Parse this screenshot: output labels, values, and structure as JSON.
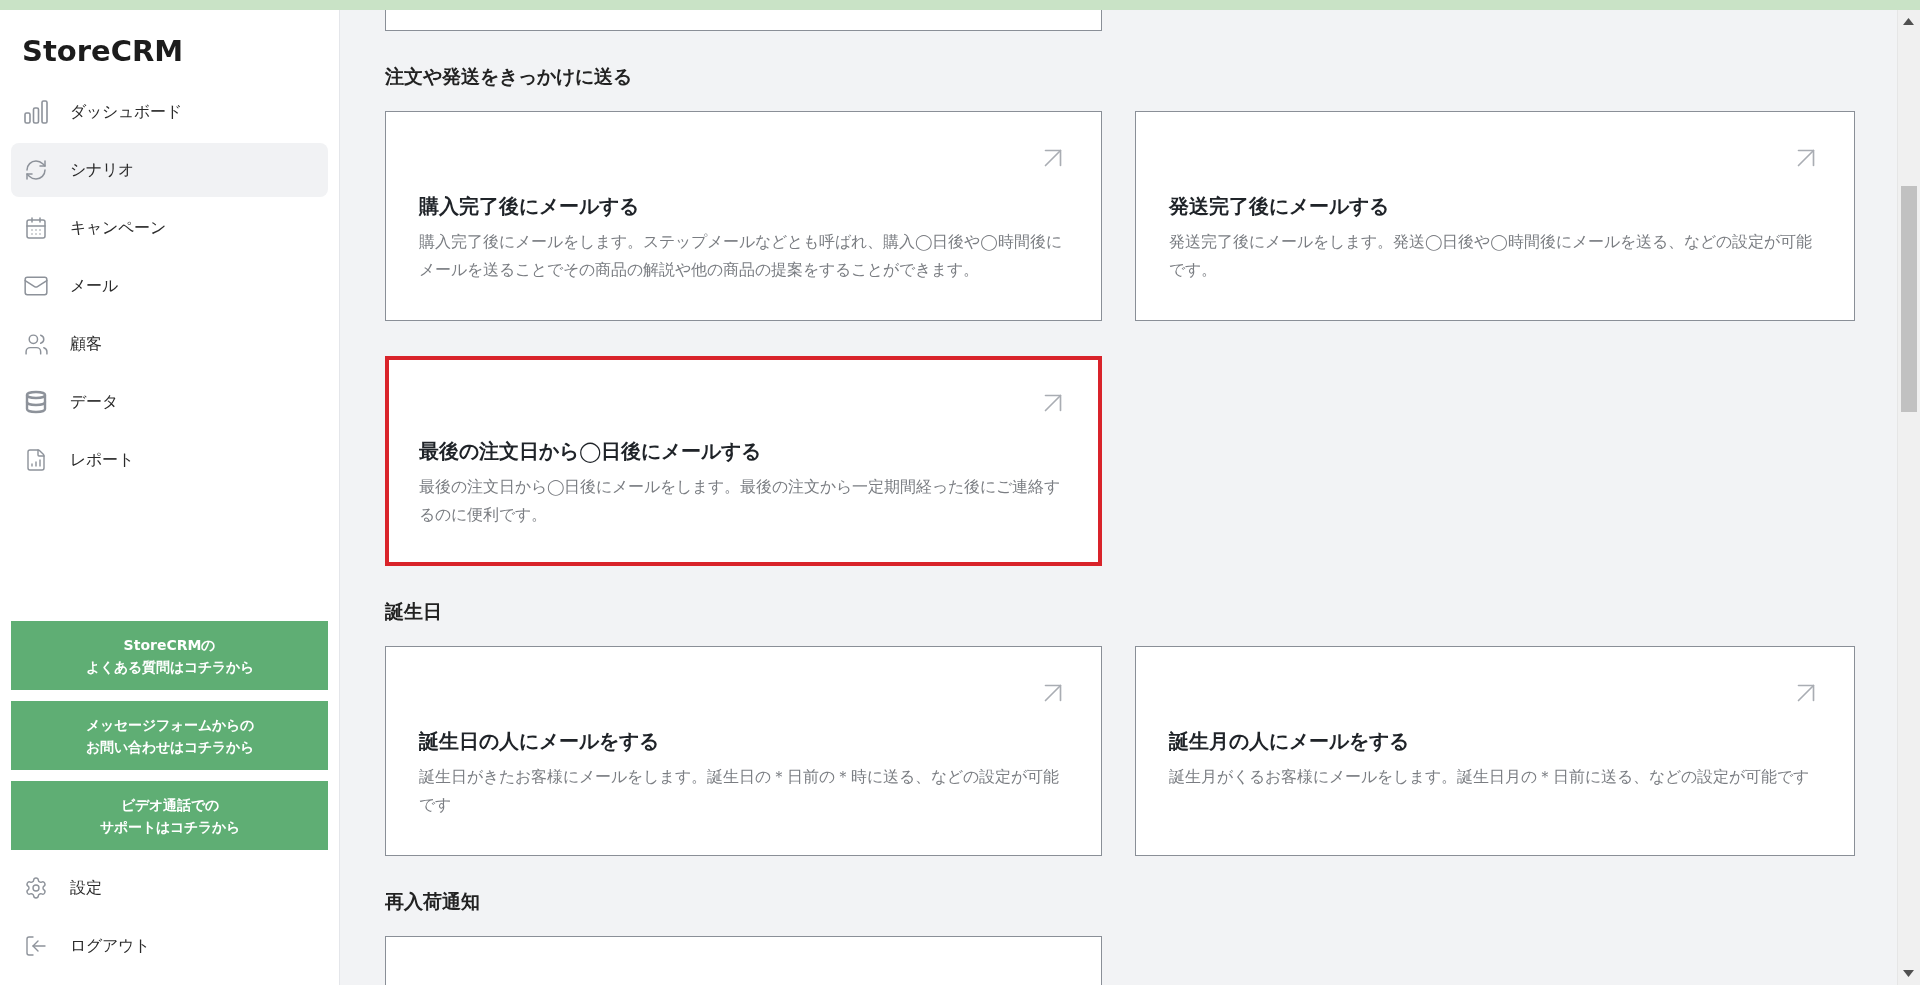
{
  "sidebar": {
    "logo": "StoreCRM",
    "nav": [
      {
        "label": "ダッシュボード",
        "selected": false
      },
      {
        "label": "シナリオ",
        "selected": true
      },
      {
        "label": "キャンペーン",
        "selected": false
      },
      {
        "label": "メール",
        "selected": false
      },
      {
        "label": "顧客",
        "selected": false
      },
      {
        "label": "データ",
        "selected": false
      },
      {
        "label": "レポート",
        "selected": false
      }
    ],
    "help_buttons": [
      {
        "lines": [
          "StoreCRMの",
          "よくある質問はコチラから"
        ]
      },
      {
        "lines": [
          "メッセージフォームからの",
          "お問い合わせはコチラから"
        ]
      },
      {
        "lines": [
          "ビデオ通話での",
          "サポートはコチラから"
        ]
      }
    ],
    "bottom_nav": [
      {
        "label": "設定"
      },
      {
        "label": "ログアウト"
      }
    ]
  },
  "sections": [
    {
      "cards": [
        {
          "kind": "cut_top"
        }
      ]
    },
    {
      "heading": "注文や発送をきっかけに送る",
      "cards": [
        {
          "kind": "full",
          "title": "購入完了後にメールする",
          "description": "購入完了後にメールをします。ステップメールなどとも呼ばれ、購入◯日後や◯時間後にメールを送ることでその商品の解説や他の商品の提案をすることができます。",
          "highlighted": false
        },
        {
          "kind": "full",
          "title": "発送完了後にメールする",
          "description": "発送完了後にメールをします。発送◯日後や◯時間後にメールを送る、などの設定が可能です。",
          "highlighted": false
        },
        {
          "kind": "full",
          "title": "最後の注文日から◯日後にメールする",
          "description": "最後の注文日から◯日後にメールをします。最後の注文から一定期間経った後にご連絡するのに便利です。",
          "highlighted": true
        }
      ]
    },
    {
      "heading": "誕生日",
      "cards": [
        {
          "kind": "full",
          "title": "誕生日の人にメールをする",
          "description": "誕生日がきたお客様にメールをします。誕生日の＊日前の＊時に送る、などの設定が可能です",
          "highlighted": false
        },
        {
          "kind": "full",
          "title": "誕生月の人にメールをする",
          "description": "誕生月がくるお客様にメールをします。誕生日月の＊日前に送る、などの設定が可能です",
          "highlighted": false
        }
      ]
    },
    {
      "heading": "再入荷通知",
      "cards": [
        {
          "kind": "cut_bottom"
        }
      ]
    }
  ]
}
